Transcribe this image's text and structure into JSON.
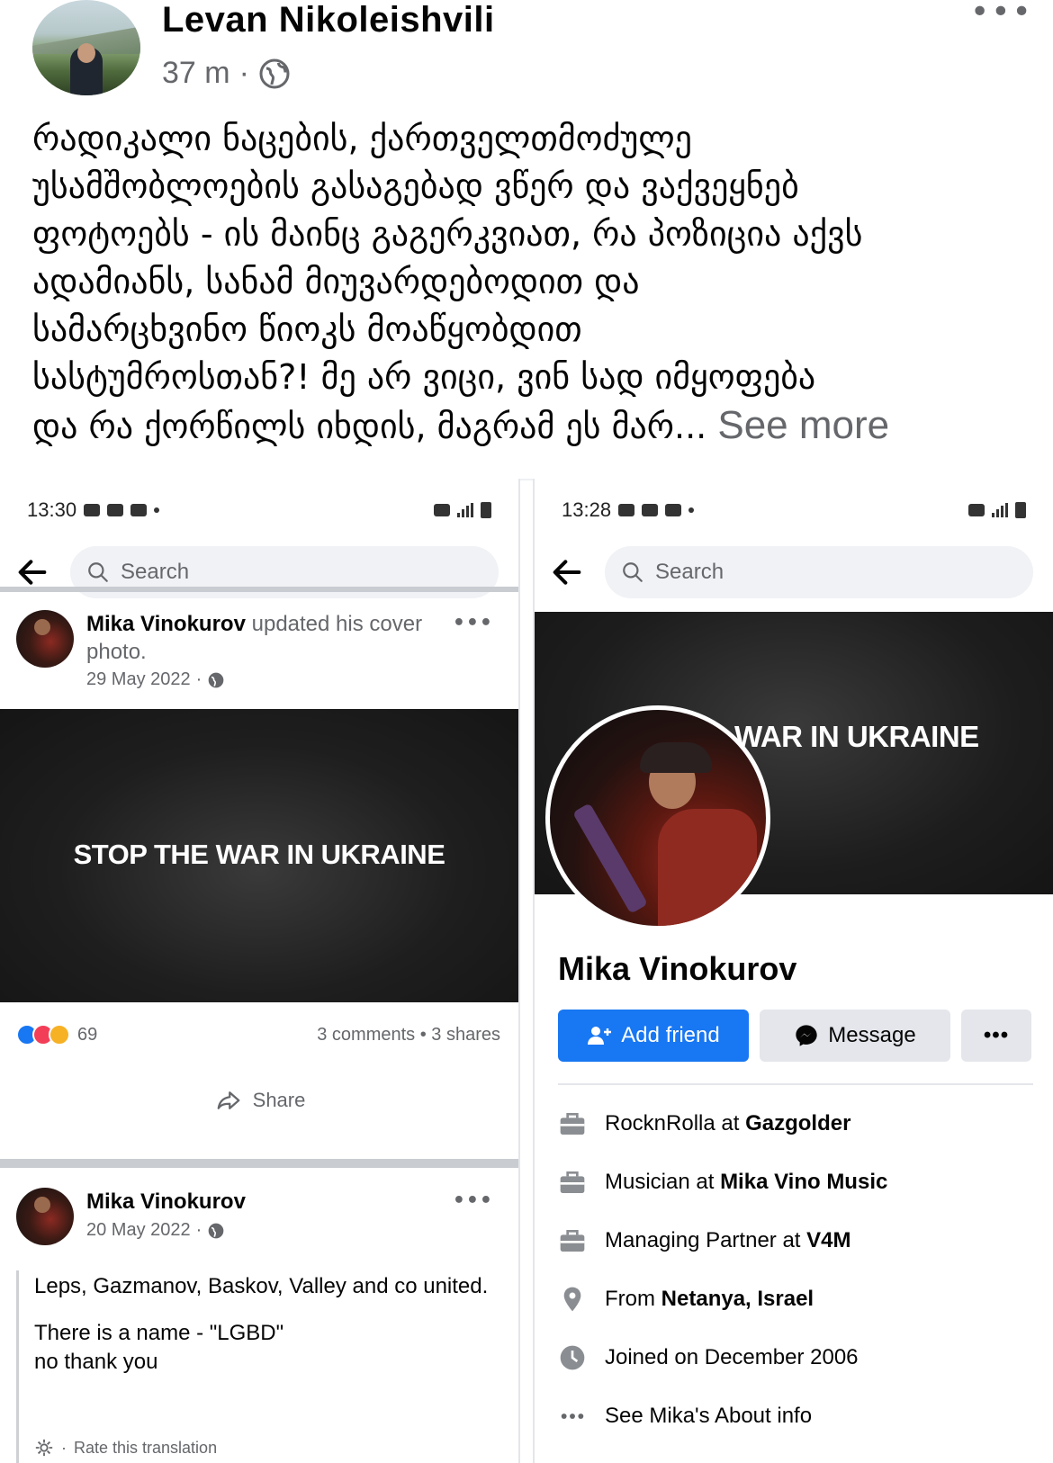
{
  "post": {
    "author": "Levan Nikoleishvili",
    "time": "37 m",
    "text_lines": [
      "რადიკალი ნაცების, ქართველთმოძულე",
      "უსამშობლოების გასაგებად ვწერ და ვაქვეყნებ",
      "ფოტოებს - ის მაინც გაგერკვიათ, რა პოზიცია აქვს",
      "ადამიანს, სანამ მიუვარდებოდით და",
      "სამარცხვინო წიოკს მოაწყობდით",
      "სასტუმროსთან?! მე არ ვიცი, ვინ სად იმყოფება",
      "და რა ქორწილს იხდის, მაგრამ ეს მარ..."
    ],
    "see_more": "See more"
  },
  "left_screen": {
    "status_time": "13:30",
    "search_placeholder": "Search",
    "post1": {
      "name": "Mika Vinokurov",
      "action": "updated his cover photo.",
      "date": "29 May 2022",
      "cover_text": "STOP THE WAR IN UKRAINE",
      "reaction_count": "69",
      "comments_shares": "3 comments • 3 shares",
      "share_label": "Share"
    },
    "post2": {
      "name": "Mika Vinokurov",
      "date": "20 May 2022",
      "body_p1": "Leps, Gazmanov, Baskov, Valley and co united.",
      "body_p2_line1": "There is a name - \"LGBD\"",
      "body_p2_line2": "no thank you",
      "rate_translation": "Rate this translation"
    }
  },
  "right_screen": {
    "status_time": "13:28",
    "search_placeholder": "Search",
    "cover_text": "WAR IN UKRAINE",
    "profile_name": "Mika Vinokurov",
    "add_friend": "Add friend",
    "message": "Message",
    "more": "•••",
    "info": [
      {
        "pre": "RocknRolla at ",
        "bold": "Gazgolder",
        "icon": "briefcase-icon"
      },
      {
        "pre": "Musician at ",
        "bold": "Mika Vino Music",
        "icon": "briefcase-icon"
      },
      {
        "pre": "Managing Partner at ",
        "bold": "V4M",
        "icon": "briefcase-icon"
      },
      {
        "pre": "From ",
        "bold": "Netanya, Israel",
        "icon": "location-pin-icon"
      },
      {
        "pre": "Joined on December 2006",
        "bold": "",
        "icon": "clock-icon"
      },
      {
        "pre": "See Mika's About info",
        "bold": "",
        "icon": "more-dots-icon"
      }
    ]
  },
  "colors": {
    "facebook_blue": "#1877f2",
    "secondary_text": "#65676b",
    "button_gray": "#e4e6eb"
  }
}
